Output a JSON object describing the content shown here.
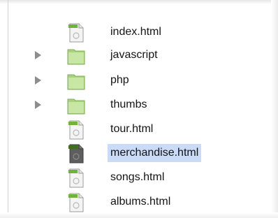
{
  "file_browser": {
    "items": [
      {
        "name": "index.html",
        "kind": "file",
        "icon": "html-file-icon"
      },
      {
        "name": "javascript",
        "kind": "folder",
        "icon": "folder-icon"
      },
      {
        "name": "php",
        "kind": "folder",
        "icon": "folder-icon"
      },
      {
        "name": "thumbs",
        "kind": "folder",
        "icon": "folder-icon"
      },
      {
        "name": "tour.html",
        "kind": "file",
        "icon": "html-file-icon"
      },
      {
        "name": "merchandise.html",
        "kind": "file",
        "icon": "html-file-icon",
        "selected": true
      },
      {
        "name": "songs.html",
        "kind": "file",
        "icon": "html-file-icon"
      },
      {
        "name": "albums.html",
        "kind": "file",
        "icon": "html-file-icon"
      }
    ]
  },
  "colors": {
    "selection_highlight": "#c9dbf7",
    "folder_green": "#b3d98a",
    "file_tab_green": "#6fb33d"
  }
}
